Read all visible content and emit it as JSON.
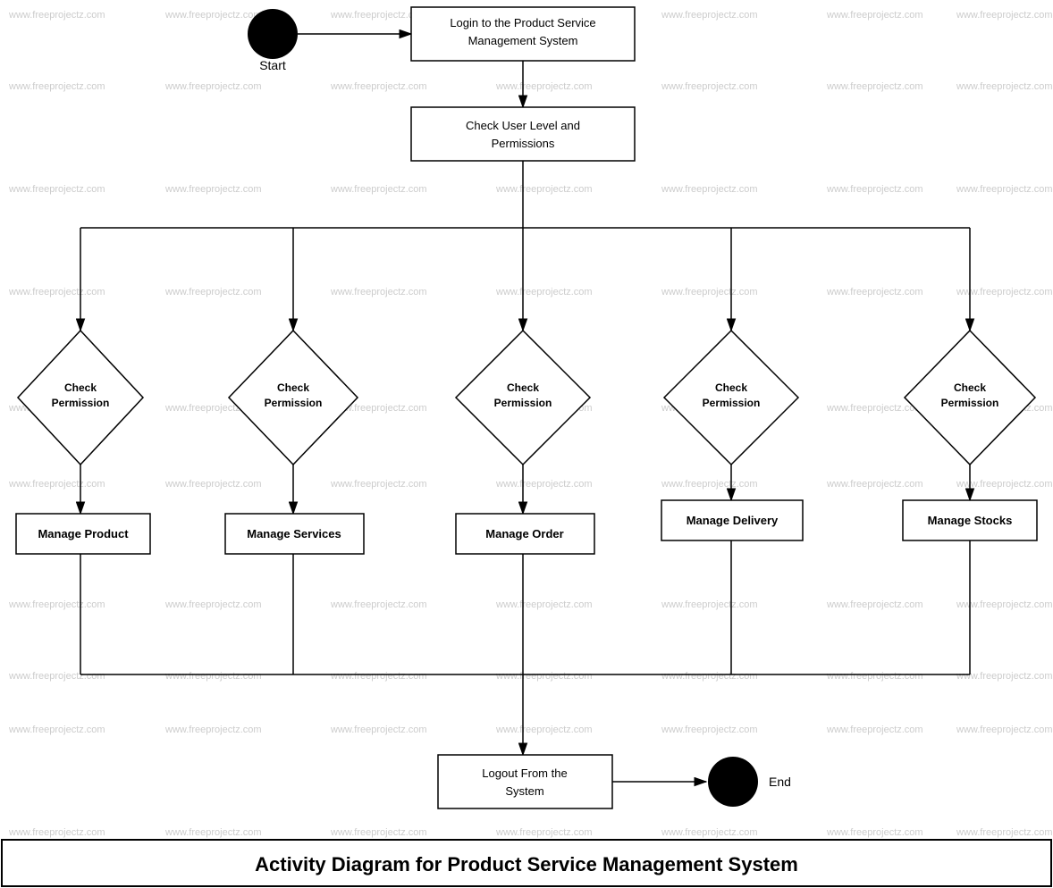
{
  "diagram": {
    "title": "Activity Diagram for Product Service Management System",
    "nodes": {
      "start_label": "Start",
      "end_label": "End",
      "login": "Login to the Product Service Management System",
      "check_permissions": "Check User Level and Permissions",
      "logout": "Logout From the System",
      "check_perm1": "Check Permission",
      "check_perm2": "Check Permission",
      "check_perm3": "Check Permission",
      "check_perm4": "Check Permission",
      "check_perm5": "Check Permission",
      "manage_product": "Manage Product",
      "manage_services": "Manage Services",
      "manage_order": "Manage Order",
      "manage_delivery": "Manage Delivery",
      "manage_stocks": "Manage Stocks"
    },
    "watermark": "www.freeprojectz.com"
  }
}
